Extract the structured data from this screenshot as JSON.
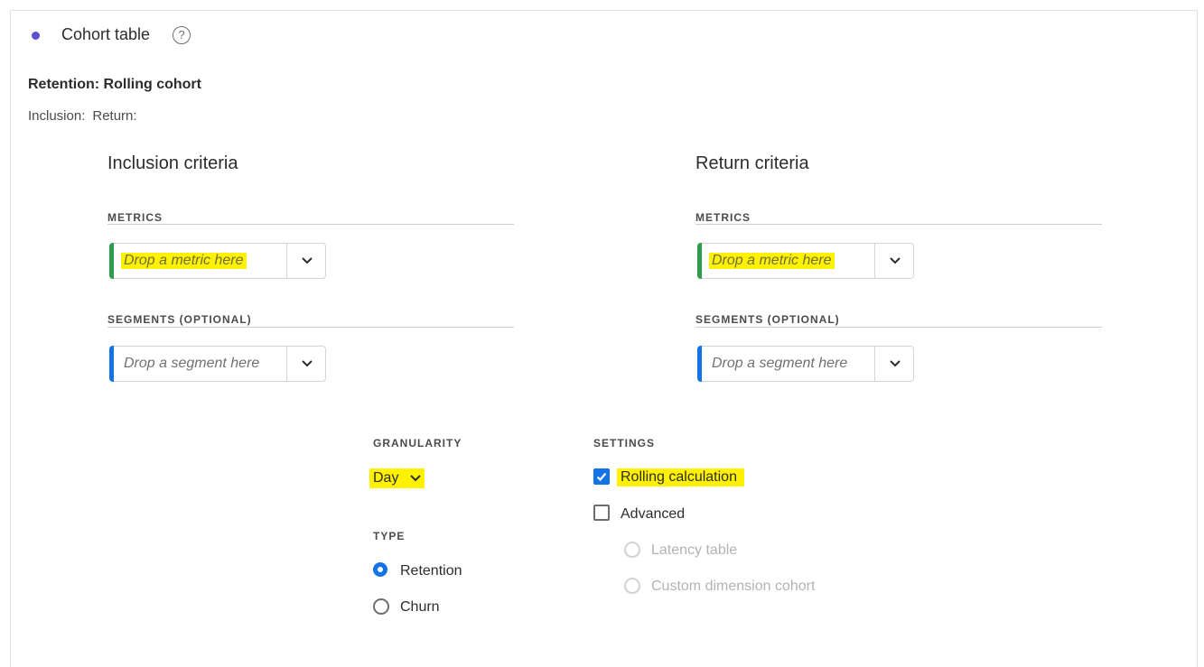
{
  "panel": {
    "title": "Cohort table",
    "help_glyph": "?",
    "subtitle": "Retention: Rolling cohort",
    "inclusion_label": "Inclusion:",
    "return_label": "Return:"
  },
  "inclusion": {
    "heading": "Inclusion criteria",
    "metrics_label": "METRICS",
    "metric_placeholder": "Drop a metric here",
    "segments_label": "SEGMENTS (OPTIONAL)",
    "segment_placeholder": "Drop a segment here"
  },
  "return": {
    "heading": "Return criteria",
    "metrics_label": "METRICS",
    "metric_placeholder": "Drop a metric here",
    "segments_label": "SEGMENTS (OPTIONAL)",
    "segment_placeholder": "Drop a segment here"
  },
  "granularity": {
    "label": "GRANULARITY",
    "value": "Day"
  },
  "type": {
    "label": "TYPE",
    "options": [
      {
        "label": "Retention",
        "selected": true
      },
      {
        "label": "Churn",
        "selected": false
      }
    ]
  },
  "settings": {
    "label": "SETTINGS",
    "rolling_calculation": {
      "label": "Rolling calculation",
      "checked": true
    },
    "advanced": {
      "label": "Advanced",
      "checked": false
    },
    "advanced_options": [
      {
        "label": "Latency table",
        "enabled": false
      },
      {
        "label": "Custom dimension cohort",
        "enabled": false
      }
    ]
  },
  "colors": {
    "accent": "#1473e6",
    "metric_bar": "#2d9d4c",
    "segment_bar": "#1473e6",
    "title_dot": "#5c4fd0",
    "highlight": "#fff200"
  }
}
